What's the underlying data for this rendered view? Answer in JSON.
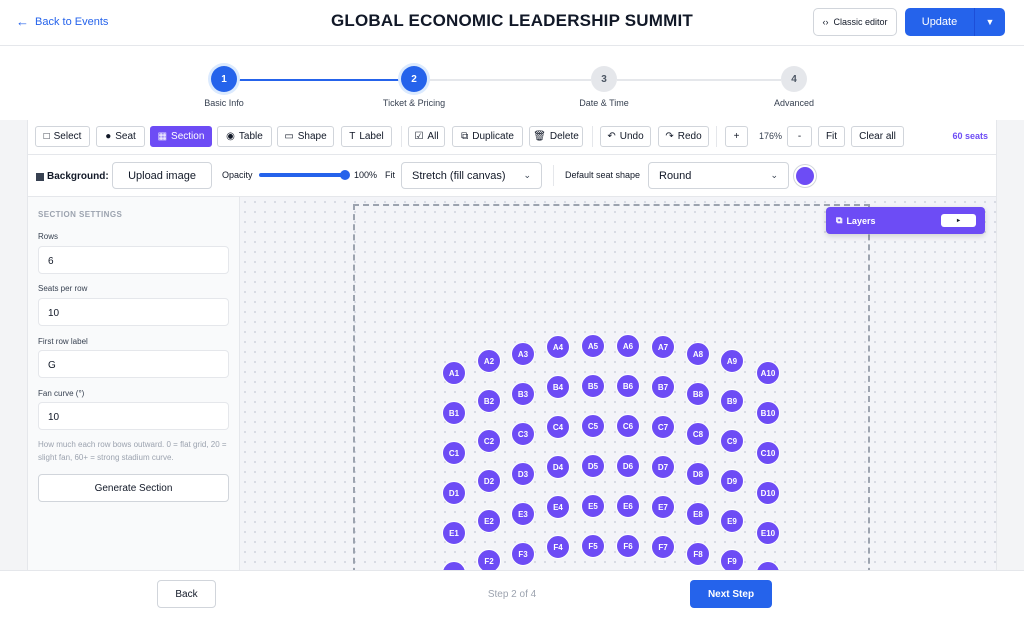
{
  "header": {
    "back_label": "Back to Events",
    "title": "GLOBAL ECONOMIC LEADERSHIP SUMMIT",
    "classic_editor_label": "Classic editor",
    "update_label": "Update"
  },
  "steps": [
    {
      "number": "1",
      "label": "Basic Info",
      "state": "active"
    },
    {
      "number": "2",
      "label": "Ticket & Pricing",
      "state": "active"
    },
    {
      "number": "3",
      "label": "Date & Time",
      "state": "inactive"
    },
    {
      "number": "4",
      "label": "Advanced",
      "state": "inactive"
    }
  ],
  "toolbar": {
    "select": "Select",
    "seat": "Seat",
    "section": "Section",
    "table": "Table",
    "shape": "Shape",
    "label": "Label",
    "all": "All",
    "duplicate": "Duplicate",
    "delete": "Delete",
    "undo": "Undo",
    "redo": "Redo",
    "zoom_in": "+",
    "zoom": "176%",
    "zoom_out": "-",
    "fit": "Fit",
    "clear_all": "Clear all",
    "seat_count": "60 seats"
  },
  "background": {
    "label": "Background:",
    "upload_label": "Upload image",
    "opacity_label": "Opacity",
    "opacity_value": "100%",
    "opacity_level": 1.0,
    "fit_label": "Fit",
    "fit_value": "Stretch (fill canvas)",
    "default_shape_label": "Default seat shape",
    "default_shape_value": "Round",
    "seat_color": "#6d4cf5"
  },
  "section_settings": {
    "title": "SECTION SETTINGS",
    "rows_label": "Rows",
    "rows_value": "6",
    "seats_per_row_label": "Seats per row",
    "seats_per_row_value": "10",
    "first_row_label_label": "First row label",
    "first_row_label_value": "G",
    "fan_curve_label": "Fan curve (°)",
    "fan_curve_value": "10",
    "help_text": "How much each row bows outward. 0 = flat grid, 20 = slight fan, 60+ = strong stadium curve.",
    "generate_label": "Generate Section"
  },
  "layers": {
    "label": "Layers",
    "toggle": "▸"
  },
  "seat_rows": [
    "A",
    "B",
    "C",
    "D",
    "E",
    "F"
  ],
  "seats_per_row": 10,
  "footer": {
    "back_label": "Back",
    "step_text": "Step 2 of 4",
    "next_label": "Next Step"
  }
}
